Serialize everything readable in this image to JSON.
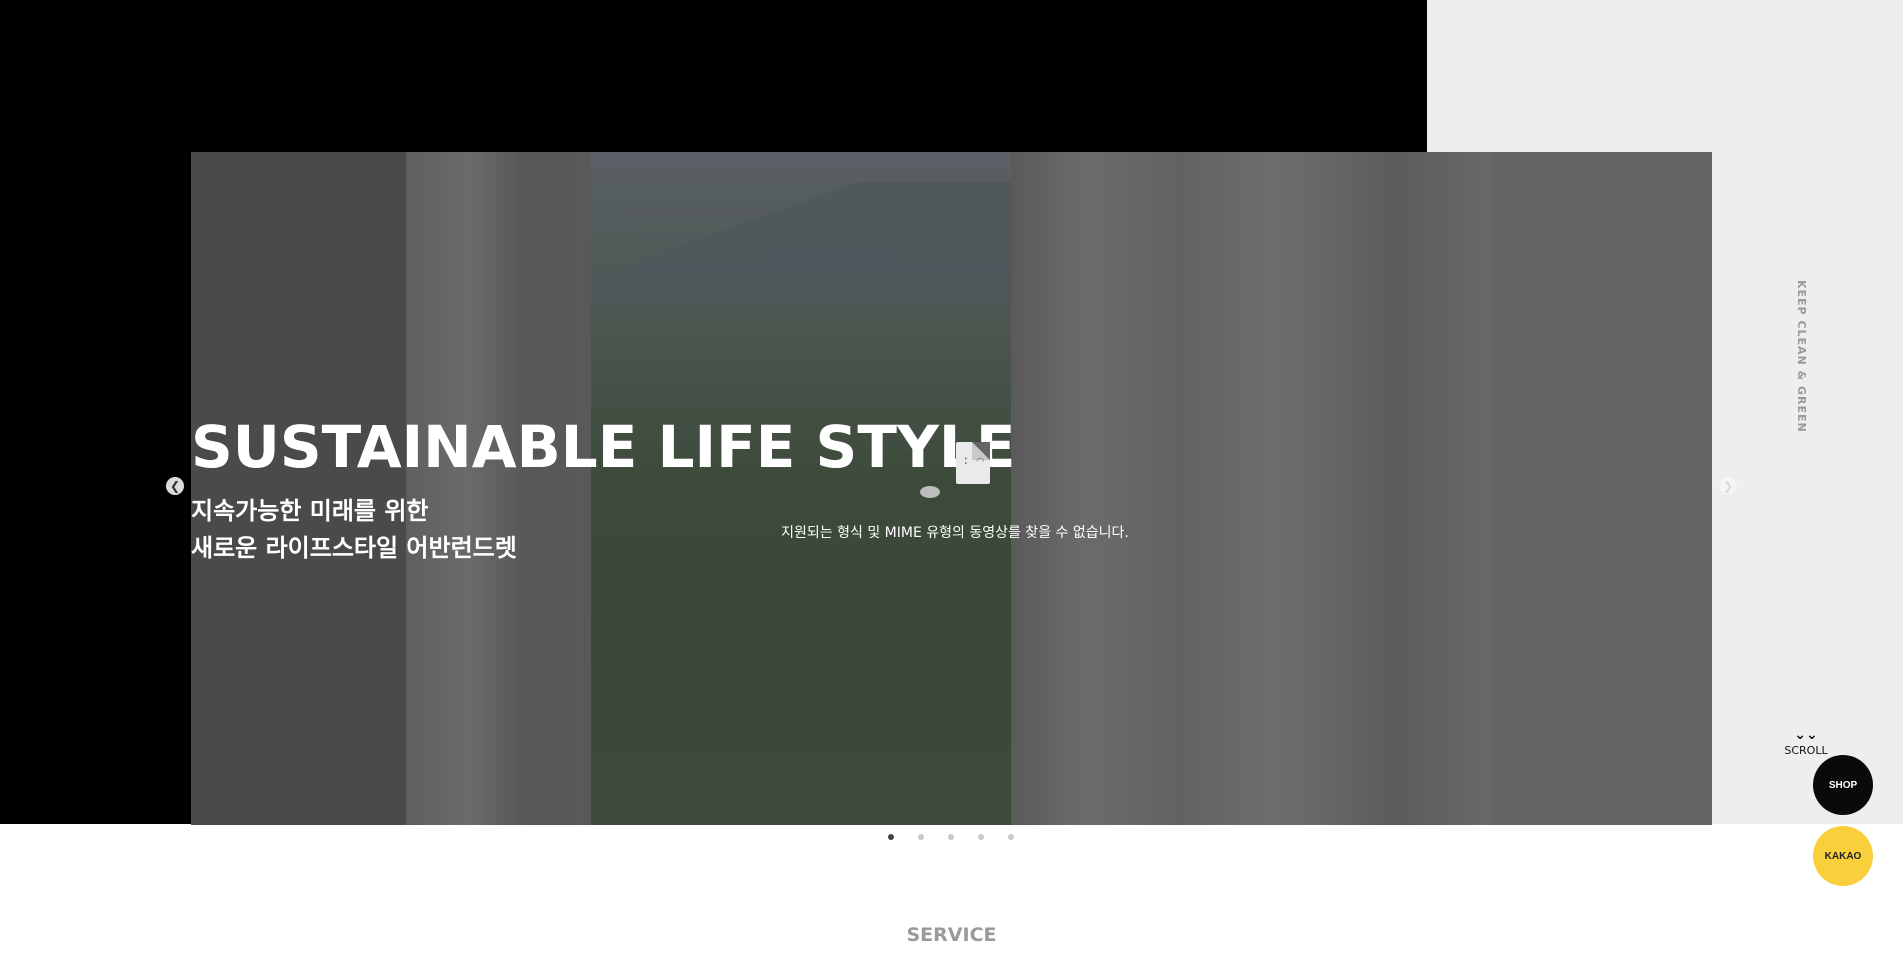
{
  "hero": {
    "title": "SUSTAINABLE LIFE STYLE",
    "subtitle_line1": "지속가능한 미래를 위한",
    "subtitle_line2": "새로운 라이프스타일 어반런드렛",
    "video_error_text": "지원되는 형식 및 MIME 유형의 동영상를 찾을 수 없습니다.",
    "face_glyph": ": ⌒"
  },
  "navigation": {
    "prev_glyph": "❮",
    "next_glyph": "❯"
  },
  "side": {
    "vertical_text": "KEEP CLEAN & GREEN",
    "scroll_chevron": "⌄⌄",
    "scroll_label": "SCROLL"
  },
  "fabs": {
    "shop_label": "SHOP",
    "kakao_label": "KAKAO"
  },
  "slider": {
    "dot_count": 5,
    "active_index": 0
  },
  "section": {
    "service_title": "SERVICE"
  },
  "colors": {
    "kakao_yellow": "#f9cf3c",
    "shop_black": "#0a0a0a",
    "hero_overlay": "#646464"
  }
}
